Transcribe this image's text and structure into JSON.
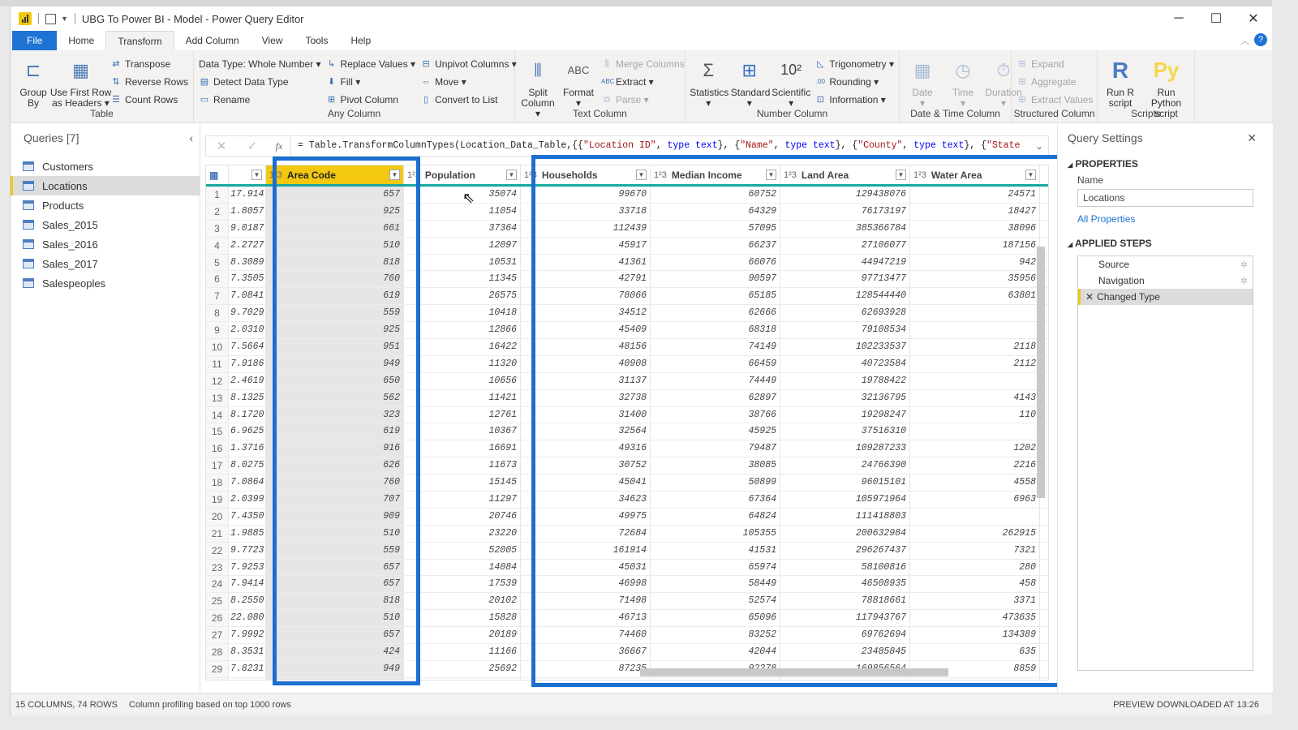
{
  "window": {
    "title": "UBG To Power BI - Model - Power Query Editor",
    "controls": [
      "minimize",
      "maximize",
      "close"
    ]
  },
  "tabs": [
    {
      "label": "File",
      "state": "file"
    },
    {
      "label": "Home",
      "state": ""
    },
    {
      "label": "Transform",
      "state": "active"
    },
    {
      "label": "Add Column",
      "state": ""
    },
    {
      "label": "View",
      "state": ""
    },
    {
      "label": "Tools",
      "state": ""
    },
    {
      "label": "Help",
      "state": ""
    }
  ],
  "ribbon": {
    "table": {
      "label": "Table",
      "group_by": "Group By",
      "first_row": "Use First Row as Headers ▾",
      "transpose": "Transpose",
      "reverse": "Reverse Rows",
      "count": "Count Rows"
    },
    "any_column": {
      "label": "Any Column",
      "data_type": "Data Type: Whole Number ▾",
      "detect": "Detect Data Type",
      "rename": "Rename",
      "replace": "Replace Values ▾",
      "fill": "Fill ▾",
      "pivot": "Pivot Column",
      "unpivot": "Unpivot Columns ▾",
      "move": "Move ▾",
      "convert": "Convert to List"
    },
    "text_column": {
      "label": "Text Column",
      "split": "Split Column ▾",
      "format": "Format ▾",
      "merge": "Merge Columns",
      "extract": "Extract ▾",
      "parse": "Parse ▾"
    },
    "number_column": {
      "label": "Number Column",
      "statistics": "Statistics ▾",
      "standard": "Standard ▾",
      "scientific": "Scientific ▾",
      "trig": "Trigonometry ▾",
      "rounding": "Rounding ▾",
      "information": "Information ▾"
    },
    "datetime": {
      "label": "Date & Time Column",
      "date": "Date ▾",
      "time": "Time ▾",
      "duration": "Duration ▾"
    },
    "structured": {
      "label": "Structured Column",
      "expand": "Expand",
      "aggregate": "Aggregate",
      "extract_values": "Extract Values"
    },
    "scripts": {
      "label": "Scripts",
      "run_r": "Run R script",
      "run_py": "Run Python script"
    }
  },
  "queries": {
    "title": "Queries [7]",
    "items": [
      {
        "label": "Customers",
        "selected": false
      },
      {
        "label": "Locations",
        "selected": true
      },
      {
        "label": "Products",
        "selected": false
      },
      {
        "label": "Sales_2015",
        "selected": false
      },
      {
        "label": "Sales_2016",
        "selected": false
      },
      {
        "label": "Sales_2017",
        "selected": false
      },
      {
        "label": "Salespeoples",
        "selected": false
      }
    ]
  },
  "formula": {
    "prefix": "= Table.TransformColumnTypes(Location_Data_Table,{{",
    "parts": [
      {
        "t": "s",
        "v": "\"Location ID\""
      },
      {
        "t": "p",
        "v": ", "
      },
      {
        "t": "k",
        "v": "type text"
      },
      {
        "t": "p",
        "v": "}, {"
      },
      {
        "t": "s",
        "v": "\"Name\""
      },
      {
        "t": "p",
        "v": ", "
      },
      {
        "t": "k",
        "v": "type text"
      },
      {
        "t": "p",
        "v": "}, {"
      },
      {
        "t": "s",
        "v": "\"County\""
      },
      {
        "t": "p",
        "v": ", "
      },
      {
        "t": "k",
        "v": "type text"
      },
      {
        "t": "p",
        "v": "}, {"
      },
      {
        "t": "s",
        "v": "\"State"
      }
    ]
  },
  "table": {
    "type_icon": "1²3",
    "columns": [
      {
        "name": "",
        "selected": false
      },
      {
        "name": "Area Code",
        "selected": true
      },
      {
        "name": "Population",
        "selected": false
      },
      {
        "name": "Households",
        "selected": false
      },
      {
        "name": "Median Income",
        "selected": false
      },
      {
        "name": "Land Area",
        "selected": false
      },
      {
        "name": "Water Area",
        "selected": false
      }
    ],
    "rows": [
      [
        "17.914",
        "657",
        "35074",
        "99670",
        "60752",
        "129438076",
        "24571"
      ],
      [
        "1.8057",
        "925",
        "11054",
        "33718",
        "64329",
        "76173197",
        "18427"
      ],
      [
        "9.0187",
        "661",
        "37364",
        "112439",
        "57095",
        "385366784",
        "38096"
      ],
      [
        "2.2727",
        "510",
        "12097",
        "45917",
        "66237",
        "27106077",
        "187156"
      ],
      [
        "8.3089",
        "818",
        "10531",
        "41361",
        "66076",
        "44947219",
        "942"
      ],
      [
        "7.3505",
        "760",
        "11345",
        "42791",
        "90597",
        "97713477",
        "35956"
      ],
      [
        "7.0841",
        "619",
        "26575",
        "78066",
        "65185",
        "128544440",
        "63801"
      ],
      [
        "9.7029",
        "559",
        "10418",
        "34512",
        "62666",
        "62693928",
        ""
      ],
      [
        "2.0310",
        "925",
        "12866",
        "45409",
        "68318",
        "79108534",
        ""
      ],
      [
        "7.5664",
        "951",
        "16422",
        "48156",
        "74149",
        "102233537",
        "2118"
      ],
      [
        "7.9186",
        "949",
        "11320",
        "40908",
        "66459",
        "40723584",
        "2112"
      ],
      [
        "2.4619",
        "650",
        "10656",
        "31137",
        "74449",
        "19788422",
        ""
      ],
      [
        "8.1325",
        "562",
        "11421",
        "32738",
        "62897",
        "32136795",
        "4143"
      ],
      [
        "8.1720",
        "323",
        "12761",
        "31400",
        "38766",
        "19298247",
        "110"
      ],
      [
        "6.9625",
        "619",
        "10367",
        "32564",
        "45925",
        "37516310",
        ""
      ],
      [
        "1.3716",
        "916",
        "16691",
        "49316",
        "79487",
        "109287233",
        "1202"
      ],
      [
        "8.0275",
        "626",
        "11673",
        "30752",
        "38085",
        "24766390",
        "2216"
      ],
      [
        "7.0864",
        "760",
        "15145",
        "45041",
        "50899",
        "96015101",
        "4558"
      ],
      [
        "2.0399",
        "707",
        "11297",
        "34623",
        "67364",
        "105971964",
        "6963"
      ],
      [
        "7.4350",
        "909",
        "20746",
        "49975",
        "64824",
        "111418803",
        ""
      ],
      [
        "1.9885",
        "510",
        "23220",
        "72684",
        "105355",
        "200632984",
        "262915"
      ],
      [
        "9.7723",
        "559",
        "52005",
        "161914",
        "41531",
        "296267437",
        "7321"
      ],
      [
        "7.9253",
        "657",
        "14084",
        "45031",
        "65974",
        "58100816",
        "280"
      ],
      [
        "7.9414",
        "657",
        "17539",
        "46998",
        "58449",
        "46508935",
        "458"
      ],
      [
        "8.2550",
        "818",
        "20102",
        "71498",
        "52574",
        "78818661",
        "3371"
      ],
      [
        "22.080",
        "510",
        "15828",
        "46713",
        "65096",
        "117943767",
        "473635"
      ],
      [
        "7.9992",
        "657",
        "20189",
        "74460",
        "83252",
        "69762694",
        "134389"
      ],
      [
        "8.3531",
        "424",
        "11166",
        "36667",
        "42044",
        "23485845",
        "635"
      ],
      [
        "7.8231",
        "949",
        "25692",
        "87235",
        "92278",
        "169856564",
        "8859"
      ],
      [
        "",
        "",
        "",
        "",
        "",
        "",
        ""
      ]
    ]
  },
  "settings": {
    "title": "Query Settings",
    "properties_label": "PROPERTIES",
    "name_label": "Name",
    "name_value": "Locations",
    "all_properties": "All Properties",
    "steps_label": "APPLIED STEPS",
    "steps": [
      {
        "label": "Source",
        "gear": true,
        "selected": false
      },
      {
        "label": "Navigation",
        "gear": true,
        "selected": false
      },
      {
        "label": "Changed Type",
        "gear": false,
        "selected": true
      }
    ]
  },
  "status": {
    "columns_rows": "15 COLUMNS, 74 ROWS",
    "profiling": "Column profiling based on top 1000 rows",
    "preview": "PREVIEW DOWNLOADED AT 13:26"
  },
  "colors": {
    "accent": "#1e73d4",
    "highlight": "#1b6fd1",
    "selected_header": "#f2c811",
    "teal": "#1aa7a0"
  }
}
